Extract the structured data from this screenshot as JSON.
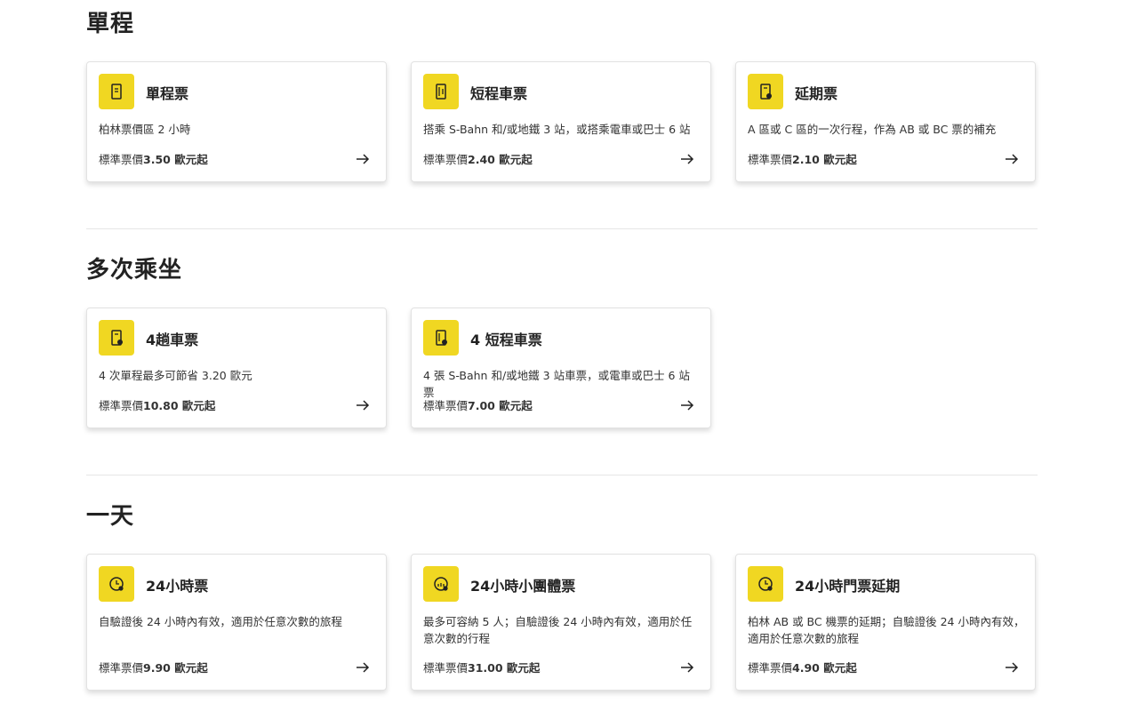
{
  "sections": [
    {
      "title": "單程",
      "cards": [
        {
          "icon": "ticket-icon",
          "title": "單程票",
          "desc": "柏林票價區 2 小時",
          "price_prefix": "標準票價",
          "price": "3.50 歐元起"
        },
        {
          "icon": "short-ticket-icon",
          "title": "短程車票",
          "desc": "搭乘 S-Bahn 和/或地鐵 3 站，或搭乘電車或巴士 6 站",
          "price_prefix": "標準票價",
          "price": "2.40 歐元起"
        },
        {
          "icon": "extension-ticket-icon",
          "title": "延期票",
          "desc": "A 區或 C 區的一次行程，作為 AB 或 BC 票的補充",
          "price_prefix": "標準票價",
          "price": "2.10 歐元起"
        }
      ]
    },
    {
      "title": "多次乘坐",
      "cards": [
        {
          "icon": "multi-ticket-icon",
          "title": "4趟車票",
          "desc": "4 次單程最多可節省 3.20 歐元",
          "price_prefix": "標準票價",
          "price": "10.80 歐元起"
        },
        {
          "icon": "multi-short-ticket-icon",
          "title": "4 短程車票",
          "desc": "4 張 S-Bahn 和/或地鐵 3 站車票，或電車或巴士 6 站票",
          "price_prefix": "標準票價",
          "price": "7.00 歐元起"
        }
      ]
    },
    {
      "title": "一天",
      "cards": [
        {
          "icon": "clock-24h-icon",
          "title": "24小時票",
          "desc": "自驗證後 24 小時內有效，適用於任意次數的旅程",
          "price_prefix": "標準票價",
          "price": "9.90 歐元起"
        },
        {
          "icon": "group-clock-icon",
          "title": "24小時小團體票",
          "desc": "最多可容納 5 人；自驗證後 24 小時內有效，適用於任意次數的行程",
          "price_prefix": "標準票價",
          "price": "31.00 歐元起"
        },
        {
          "icon": "clock-extension-icon",
          "title": "24小時門票延期",
          "desc": "柏林 AB 或 BC 機票的延期；自驗證後 24 小時內有效，適用於任意次數的旅程",
          "price_prefix": "標準票價",
          "price": "4.90 歐元起"
        }
      ]
    }
  ],
  "colors": {
    "accent": "#f0d722"
  }
}
